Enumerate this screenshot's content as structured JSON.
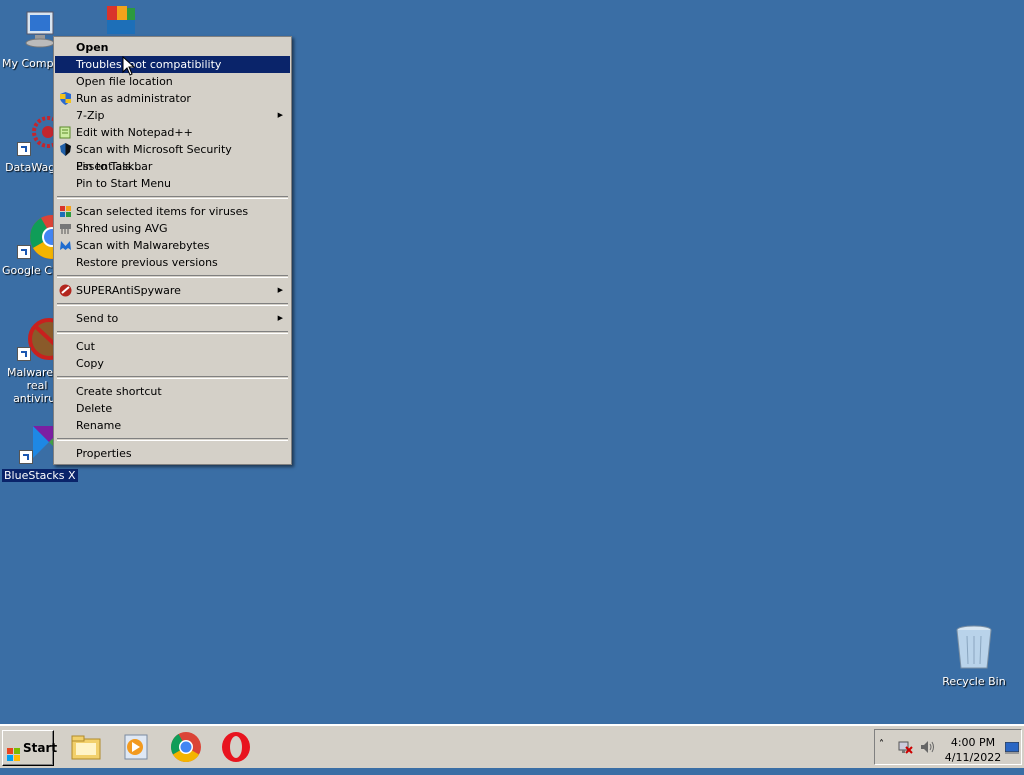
{
  "desktop": {
    "icons": [
      {
        "label": "My Computer"
      },
      {
        "label": "DataWagon"
      },
      {
        "label": "Google Chrome"
      },
      {
        "label": "Malwarebytes real antivirus"
      },
      {
        "label": "BlueStacks X"
      },
      {
        "label": "Recycle Bin"
      }
    ]
  },
  "context_menu": {
    "items": [
      {
        "label": "Open"
      },
      {
        "label": "Troubleshoot compatibility"
      },
      {
        "label": "Open file location"
      },
      {
        "label": "Run as administrator"
      },
      {
        "label": "7-Zip"
      },
      {
        "label": "Edit with Notepad++"
      },
      {
        "label": "Scan with Microsoft Security Essentials..."
      },
      {
        "label": "Pin to Taskbar"
      },
      {
        "label": "Pin to Start Menu"
      },
      {
        "label": "Scan selected items for viruses"
      },
      {
        "label": "Shred using AVG"
      },
      {
        "label": "Scan with Malwarebytes"
      },
      {
        "label": "Restore previous versions"
      },
      {
        "label": "SUPERAntiSpyware"
      },
      {
        "label": "Send to"
      },
      {
        "label": "Cut"
      },
      {
        "label": "Copy"
      },
      {
        "label": "Create shortcut"
      },
      {
        "label": "Delete"
      },
      {
        "label": "Rename"
      },
      {
        "label": "Properties"
      }
    ]
  },
  "taskbar": {
    "start_label": "Start",
    "clock_time": "4:00 PM",
    "clock_date": "4/11/2022"
  },
  "colors": {
    "desktop": "#3a6ea5",
    "menu_highlight": "#0a246a",
    "menu_bg": "#d4d0c8"
  }
}
